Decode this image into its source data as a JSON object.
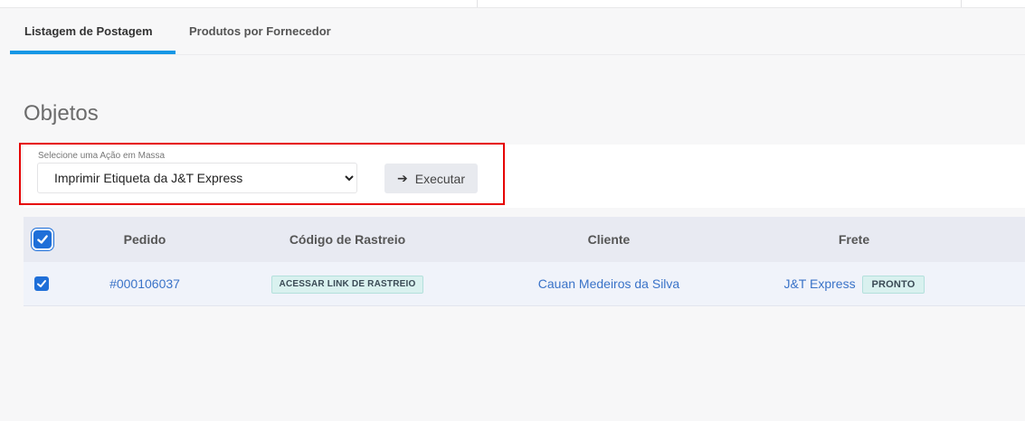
{
  "tabs": [
    {
      "label": "Listagem de Postagem",
      "active": true
    },
    {
      "label": "Produtos por Fornecedor",
      "active": false
    }
  ],
  "page": {
    "title": "Objetos"
  },
  "bulk_action": {
    "label": "Selecione uma Ação em Massa",
    "selected": "Imprimir Etiqueta da J&T Express",
    "execute_label": "Executar"
  },
  "table": {
    "columns": [
      "Pedido",
      "Código de Rastreio",
      "Cliente",
      "Frete"
    ],
    "rows": [
      {
        "checked": true,
        "pedido": "#000106037",
        "rastreio": "ACESSAR LINK DE RASTREIO",
        "cliente": "Cauan Medeiros da Silva",
        "frete": "J&T Express",
        "status": "PRONTO"
      }
    ]
  },
  "colors": {
    "accent": "#1597e5",
    "checkbox": "#1f6fd8",
    "link": "#3a73c8",
    "highlight": "#e60000",
    "badge_bg": "#d9f1ef"
  }
}
